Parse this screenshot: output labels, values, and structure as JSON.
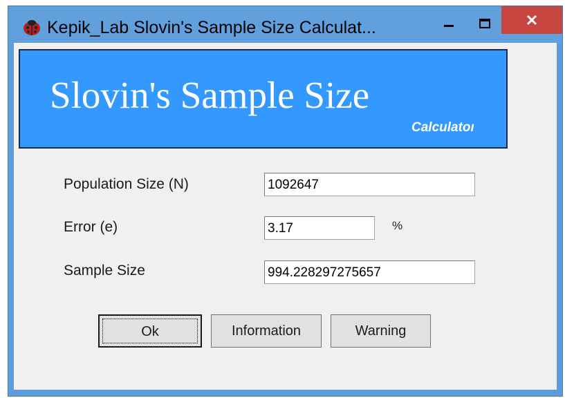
{
  "window": {
    "title": "Kepik_Lab Slovin's Sample Size Calculat..."
  },
  "banner": {
    "title": "Slovin's Sample Size",
    "subtitle": "Calculatoı"
  },
  "form": {
    "population_label": "Population Size (N)",
    "population_value": "1092647",
    "error_label": "Error (e)",
    "error_value": "3.17",
    "error_unit": "%",
    "sample_label": "Sample Size",
    "sample_value": "994.228297275657"
  },
  "buttons": {
    "ok": "Ok",
    "information": "Information",
    "warning": "Warning"
  },
  "colors": {
    "titlebar": "#62a0dd",
    "banner": "#3399ff",
    "close_button": "#c7463f",
    "client_background": "#f0f0f0"
  },
  "icons": {
    "app": "ladybug-icon",
    "minimize": "minimize-icon",
    "maximize": "maximize-icon",
    "close": "close-icon"
  }
}
